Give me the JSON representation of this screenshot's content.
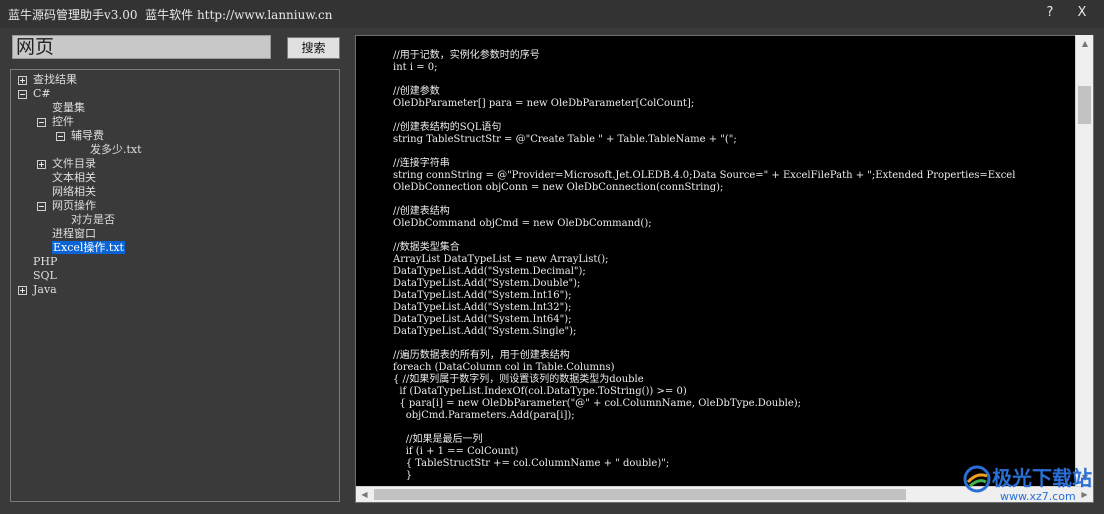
{
  "window": {
    "title": "蓝牛源码管理助手v3.00  蓝牛软件 http://www.lanniuw.cn",
    "help_label": "?",
    "close_label": "X"
  },
  "search": {
    "value": "网页",
    "button_label": "搜索"
  },
  "tree": {
    "nodes": [
      {
        "label": "查找结果",
        "expander": "plus"
      },
      {
        "label": "C#",
        "expander": "minus"
      },
      {
        "label": "变量集",
        "expander": "none"
      },
      {
        "label": "控件",
        "expander": "minus"
      },
      {
        "label": "辅导费",
        "expander": "minus"
      },
      {
        "label": "发多少.txt",
        "expander": "none"
      },
      {
        "label": "文件目录",
        "expander": "plus"
      },
      {
        "label": "文本相关",
        "expander": "none"
      },
      {
        "label": "网络相关",
        "expander": "none"
      },
      {
        "label": "网页操作",
        "expander": "minus"
      },
      {
        "label": "对方是否",
        "expander": "none"
      },
      {
        "label": "进程窗口",
        "expander": "none"
      },
      {
        "label": "Excel操作.txt",
        "expander": "none",
        "selected": true
      },
      {
        "label": "PHP",
        "expander": "none"
      },
      {
        "label": "SQL",
        "expander": "none"
      },
      {
        "label": "Java",
        "expander": "plus"
      }
    ]
  },
  "editor": {
    "code": "//用于记数，实例化参数时的序号\nint i = 0;\n\n//创建参数\nOleDbParameter[] para = new OleDbParameter[ColCount];\n\n//创建表结构的SQL语句\nstring TableStructStr = @\"Create Table \" + Table.TableName + \"(\";\n\n//连接字符串\nstring connString = @\"Provider=Microsoft.Jet.OLEDB.4.0;Data Source=\" + ExcelFilePath + \";Extended Properties=Excel\nOleDbConnection objConn = new OleDbConnection(connString);\n\n//创建表结构\nOleDbCommand objCmd = new OleDbCommand();\n\n//数据类型集合\nArrayList DataTypeList = new ArrayList();\nDataTypeList.Add(\"System.Decimal\");\nDataTypeList.Add(\"System.Double\");\nDataTypeList.Add(\"System.Int16\");\nDataTypeList.Add(\"System.Int32\");\nDataTypeList.Add(\"System.Int64\");\nDataTypeList.Add(\"System.Single\");\n\n//遍历数据表的所有列，用于创建表结构\nforeach (DataColumn col in Table.Columns)\n{ //如果列属于数字列，则设置该列的数据类型为double\n  if (DataTypeList.IndexOf(col.DataType.ToString()) >= 0)\n  { para[i] = new OleDbParameter(\"@\" + col.ColumnName, OleDbType.Double);\n    objCmd.Parameters.Add(para[i]);\n\n    //如果是最后一列\n    if (i + 1 == ColCount)\n    { TableStructStr += col.ColumnName + \" double)\";\n    }"
  },
  "watermark": {
    "brand": "极光下载站",
    "url": "www.xz7.com"
  },
  "colors": {
    "selection": "#0a64d6",
    "editor_background": "#000000",
    "watermark": "#2a6fd6"
  }
}
